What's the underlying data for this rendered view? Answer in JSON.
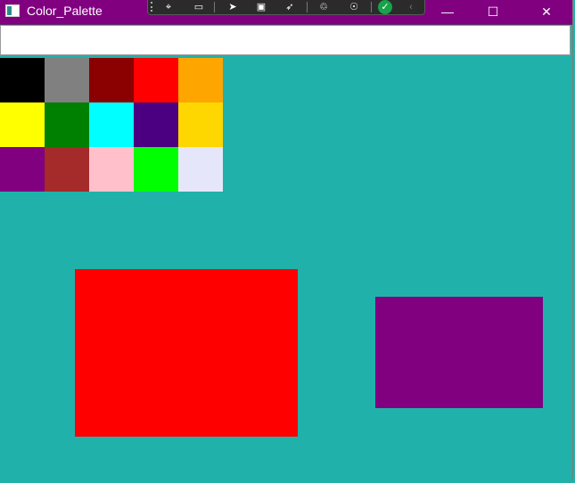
{
  "window": {
    "title": "Color_Palette",
    "titlebar_color": "#800080",
    "client_background": "#20b2aa"
  },
  "debug_toolbar": {
    "buttons": [
      "select-element-icon",
      "video-icon",
      "cursor-pointer-icon",
      "frame-icon",
      "cursor-target-icon",
      "hot-reload-icon",
      "accessibility-icon",
      "check-icon",
      "chevron-left-icon"
    ]
  },
  "caption_buttons": {
    "minimize": "—",
    "maximize": "☐",
    "close": "✕"
  },
  "text_input": {
    "value": ""
  },
  "palette": {
    "rows": [
      [
        "#000000",
        "#808080",
        "#8b0000",
        "#ff0000",
        "#ffa500"
      ],
      [
        "#ffff00",
        "#008000",
        "#00ffff",
        "#4b0082",
        "#ffd700"
      ],
      [
        "#800080",
        "#a52a2a",
        "#ffc0cb",
        "#00ff00",
        "#e6e6fa"
      ]
    ]
  },
  "shapes": [
    {
      "name": "red-rectangle",
      "color": "#ff0000"
    },
    {
      "name": "purple-rectangle",
      "color": "#800080"
    }
  ]
}
